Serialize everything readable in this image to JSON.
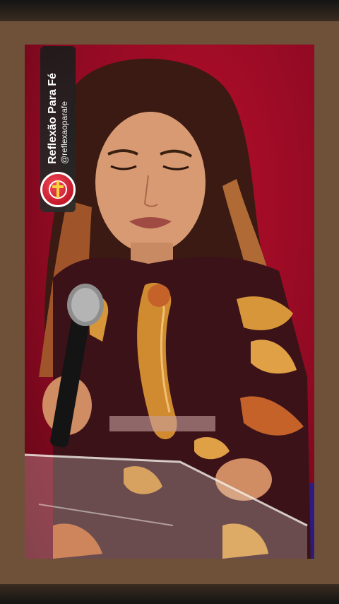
{
  "overlay": {
    "channel_name": "Reflexão Para Fé",
    "channel_handle": "@reflexaoparafe",
    "logo_icon": "cross-icon"
  },
  "colors": {
    "page_frame": "#6e5138",
    "stage_background": "#b40d2a",
    "logo_background": "#c3182a"
  }
}
